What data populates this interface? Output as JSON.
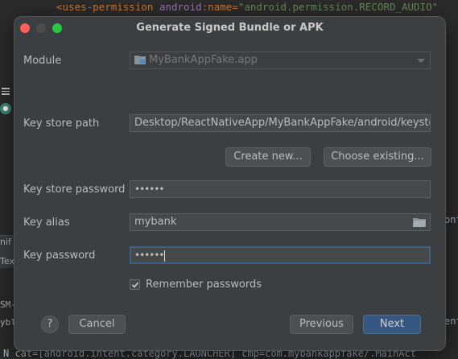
{
  "background": {
    "code_top": {
      "tag": "<uses-permission",
      "attr": "android",
      "colon": ":name=",
      "value": "\"android.permission.RECORD_AUDIO\""
    },
    "left_labels": [
      "nif",
      "Tex",
      "SM-",
      "ybl"
    ],
    "right_labels": [
      "ont",
      "ent"
    ],
    "bottom_line": "N cat=[android.intent.category.LAUNCHER] cmp=com.mybankappfake/.MainAct"
  },
  "dialog": {
    "title": "Generate Signed Bundle or APK",
    "module": {
      "label": "Module",
      "value": "MyBankAppFake.app"
    },
    "key_store_path": {
      "label": "Key store path",
      "value": "Desktop/ReactNativeApp/MyBankAppFake/android/keystore"
    },
    "create_new_label": "Create new...",
    "choose_existing_label": "Choose existing...",
    "key_store_password": {
      "label": "Key store password",
      "value": "••••••"
    },
    "key_alias": {
      "label": "Key alias",
      "value": "mybank"
    },
    "key_password": {
      "label": "Key password",
      "value": "••••••"
    },
    "remember_passwords": {
      "label": "Remember passwords",
      "checked": true
    },
    "help_label": "?",
    "cancel_label": "Cancel",
    "previous_label": "Previous",
    "next_label": "Next"
  },
  "colors": {
    "dialog_bg": "#3c3f41",
    "field_bg": "#45494a",
    "primary_button": "#365880",
    "focus_ring": "#3d6185"
  }
}
